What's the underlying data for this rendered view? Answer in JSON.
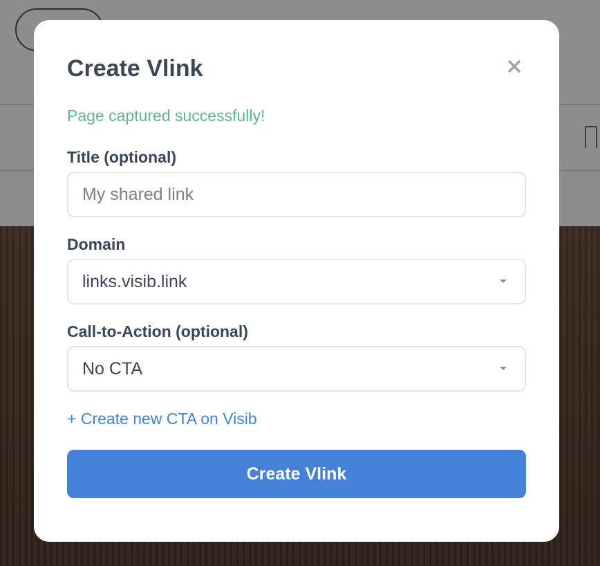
{
  "modal": {
    "title": "Create Vlink",
    "close_icon": "close-icon",
    "status_message": "Page captured successfully!",
    "status_color": "#5fb88b",
    "title_field": {
      "label": "Title (optional)",
      "placeholder": "My shared link",
      "value": ""
    },
    "domain_field": {
      "label": "Domain",
      "selected": "links.visib.link"
    },
    "cta_field": {
      "label": "Call-to-Action (optional)",
      "selected": "No CTA"
    },
    "create_cta_link": "+ Create new CTA on Visib",
    "submit_label": "Create Vlink",
    "accent_color": "#4382d8"
  }
}
